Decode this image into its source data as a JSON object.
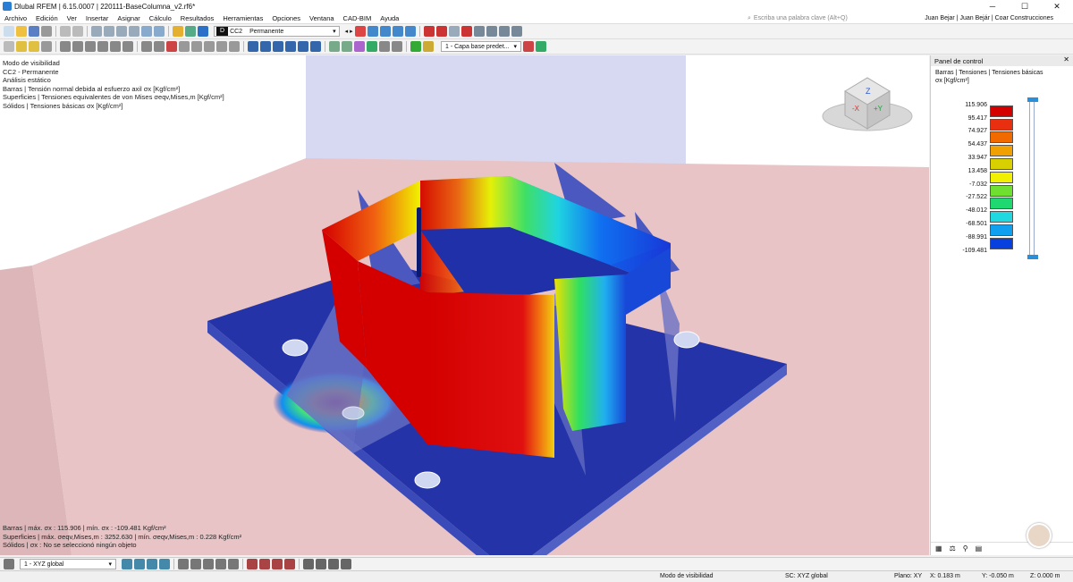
{
  "window": {
    "title": "Dlubal RFEM | 6.15.0007 | 220111-BaseColumna_v2.rf6*"
  },
  "menu": [
    "Archivo",
    "Edición",
    "Ver",
    "Insertar",
    "Asignar",
    "Cálculo",
    "Resultados",
    "Herramientas",
    "Opciones",
    "Ventana",
    "CAD-BIM",
    "Ayuda"
  ],
  "search": {
    "placeholder": "Escriba una palabra clave (Alt+Q)"
  },
  "user": {
    "name": "Juan Bejar | Juan Bejár | Coar Construcciones"
  },
  "toolbar": {
    "load_case": {
      "type_letter": "D",
      "code": "CC2",
      "name": "Permanente"
    },
    "layer": "1 - Capa base predet..."
  },
  "viewport": {
    "info_top": [
      "Modo de visibilidad",
      "CC2 - Permanente",
      "Análisis estático",
      "Barras | Tensión normal debida al esfuerzo axil σx [Kgf/cm²]",
      "Superficies | Tensiones equivalentes de von Mises σeqv,Mises,m [Kgf/cm²]",
      "Sólidos | Tensiones básicas σx [Kgf/cm²]"
    ],
    "info_bottom": [
      "Barras | máx. σx : 115.906 | mín. σx : -109.481 Kgf/cm²",
      "Superficies | máx. σeqv,Mises,m : 3252.630 | mín. σeqv,Mises,m : 0.228 Kgf/cm²",
      "Sólidos | σx : No se seleccionó ningún objeto"
    ]
  },
  "control_panel": {
    "title": "Panel de control",
    "subtitle": "Barras | Tensiones | Tensiones básicas",
    "unit": "σx [Kgf/cm²]",
    "scale_values": [
      "115.906",
      "95.417",
      "74.927",
      "54.437",
      "33.947",
      "13.458",
      "-7.032",
      "-27.522",
      "-48.012",
      "-68.501",
      "-88.991",
      "-109.481"
    ],
    "scale_colors": [
      "#d40000",
      "#e83010",
      "#f06a00",
      "#f0a000",
      "#d8d000",
      "#f0f000",
      "#70e030",
      "#20d870",
      "#20d8e0",
      "#10a0f0",
      "#0840e0",
      "#0010a0"
    ]
  },
  "bottom": {
    "coordinate_system": "1 - XYZ global"
  },
  "status": {
    "mode": "Modo de visibilidad",
    "sc": "SC: XYZ global",
    "plane": "Plano: XY",
    "x": "X: 0.183 m",
    "y": "Y: -0.050 m",
    "z": "Z: 0.000 m"
  }
}
